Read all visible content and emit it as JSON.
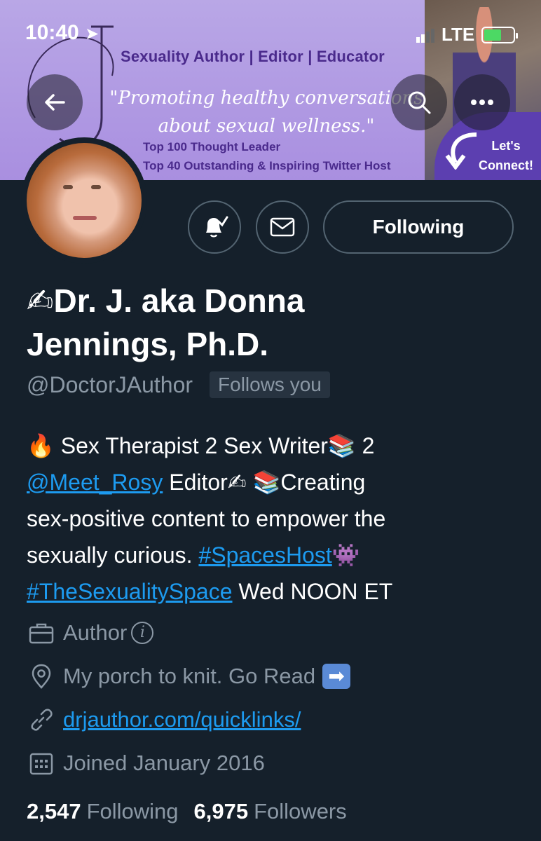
{
  "status_bar": {
    "time": "10:40",
    "network": "LTE"
  },
  "banner": {
    "title": "Sexuality Author | Editor | Educator",
    "quote_line1": "\"Promoting healthy conversations",
    "quote_line2": "about sexual wellness.\"",
    "line1": "Top 100 Thought Leader",
    "line2": "Top 40 Outstanding & Inspiring Twitter Host",
    "connect_line1": "Let's",
    "connect_line2": "Connect!"
  },
  "actions": {
    "follow_label": "Following"
  },
  "profile": {
    "name_line1": "✍Dr. J. aka Donna",
    "name_line2": "Jennings, Ph.D.",
    "handle": "@DoctorJAuthor",
    "follows_you": "Follows you",
    "bio": {
      "p1": "🔥 Sex Therapist 2 Sex Writer📚 2",
      "mention": "@Meet_Rosy",
      "p2": " Editor✍  📚Creating",
      "p3": "sex-positive content to empower the",
      "p4": "sexually curious. ",
      "hashtag1": "#SpacesHost",
      "p5": "👾",
      "hashtag2": "#TheSexualitySpace",
      "p6": " Wed NOON ET"
    },
    "category": "Author",
    "location": "My porch to knit. Go Read",
    "website": "drjauthor.com/quicklinks/",
    "joined": "Joined January 2016",
    "following_count": "2,547",
    "following_label": "Following",
    "followers_count": "6,975",
    "followers_label": "Followers"
  },
  "colors": {
    "background": "#15202b",
    "accent": "#1d9bf0",
    "muted": "#8b98a5",
    "banner": "#b9a7e6"
  }
}
